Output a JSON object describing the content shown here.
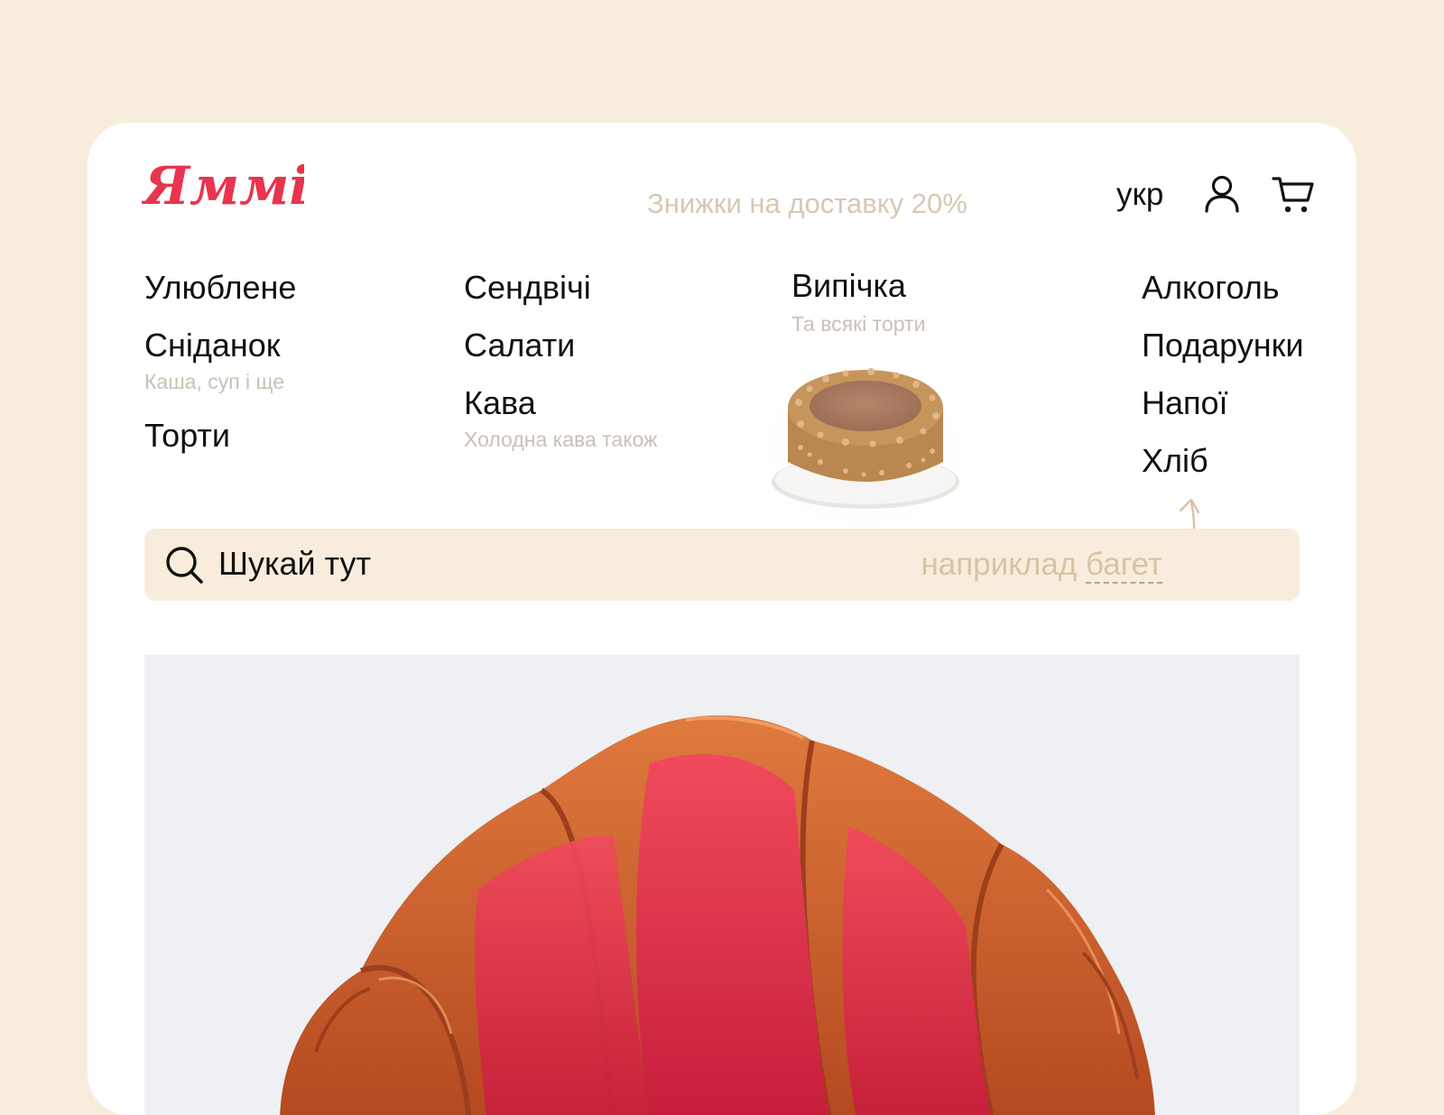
{
  "header": {
    "logo_text": "Яммі",
    "promo": "Знижки на доставку 20%",
    "language": "укр",
    "user_icon": "user-icon",
    "cart_icon": "cart-icon"
  },
  "menu": {
    "col1": [
      {
        "label": "Улюблене",
        "sub": ""
      },
      {
        "label": "Сніданок",
        "sub": "Каша, суп і ще"
      },
      {
        "label": "Торти",
        "sub": ""
      }
    ],
    "col2": [
      {
        "label": "Сендвічі",
        "sub": ""
      },
      {
        "label": "Салати",
        "sub": ""
      },
      {
        "label": "Кава",
        "sub": "Холодна кава також"
      }
    ],
    "col3": [
      {
        "label": "Випічка",
        "sub": "Та всякі торти"
      }
    ],
    "col4": [
      {
        "label": "Алкоголь",
        "sub": ""
      },
      {
        "label": "Подарунки",
        "sub": ""
      },
      {
        "label": "Напої",
        "sub": ""
      },
      {
        "label": "Хліб",
        "sub": ""
      }
    ]
  },
  "search": {
    "icon": "search-icon",
    "label": "Шукай тут",
    "hint_prefix": "наприклад ",
    "hint_word": "багет"
  },
  "colors": {
    "background": "#f8eddc",
    "brand": "#e8344e",
    "muted": "#d6c8b5"
  }
}
